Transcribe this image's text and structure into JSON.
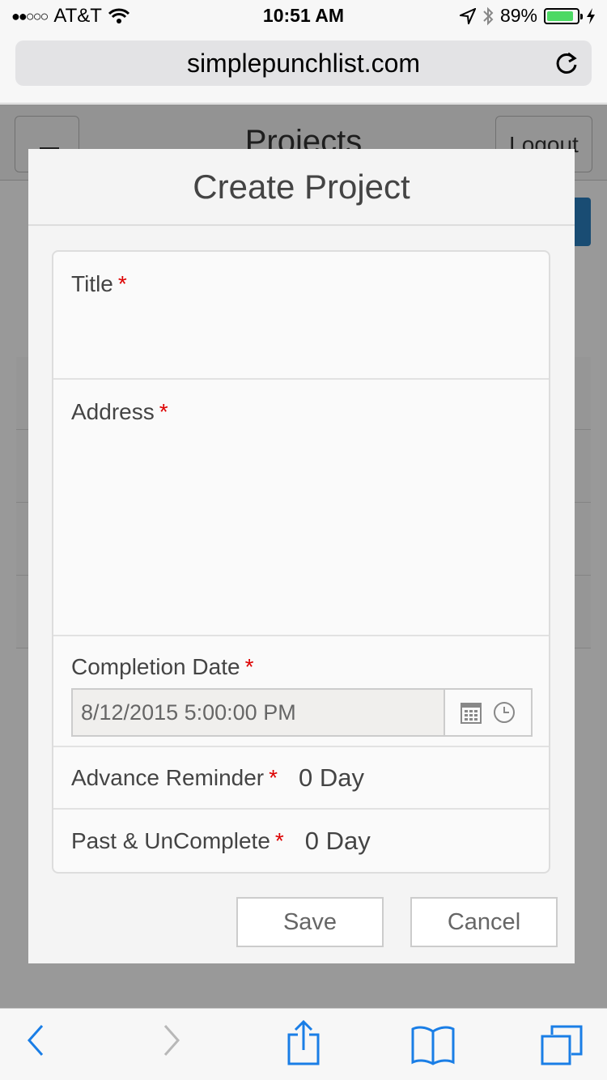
{
  "status_bar": {
    "carrier": "AT&T",
    "signal": "●●○○○",
    "time": "10:51 AM",
    "battery_percent": "89%",
    "battery_level": 0.89
  },
  "browser": {
    "url": "simplepunchlist.com"
  },
  "page": {
    "title": "Projects",
    "logout_label": "Logout"
  },
  "modal": {
    "title": "Create Project",
    "fields": {
      "title": {
        "label": "Title",
        "required_mark": "*",
        "value": ""
      },
      "address": {
        "label": "Address",
        "required_mark": "*",
        "value": ""
      },
      "completion_date": {
        "label": "Completion Date",
        "required_mark": "*",
        "value": "8/12/2015 5:00:00 PM"
      },
      "advance_reminder": {
        "label": "Advance Reminder",
        "required_mark": "*",
        "value": "0 Day"
      },
      "past_uncomplete": {
        "label": "Past & UnComplete",
        "required_mark": "*",
        "value": "0 Day"
      }
    },
    "save_label": "Save",
    "cancel_label": "Cancel"
  },
  "toolbar": {
    "icons": [
      "back-icon",
      "forward-icon",
      "share-icon",
      "bookmarks-icon",
      "tabs-icon"
    ]
  },
  "colors": {
    "accent": "#1a7ee6",
    "required": "#dd0000",
    "battery": "#4cd964"
  }
}
